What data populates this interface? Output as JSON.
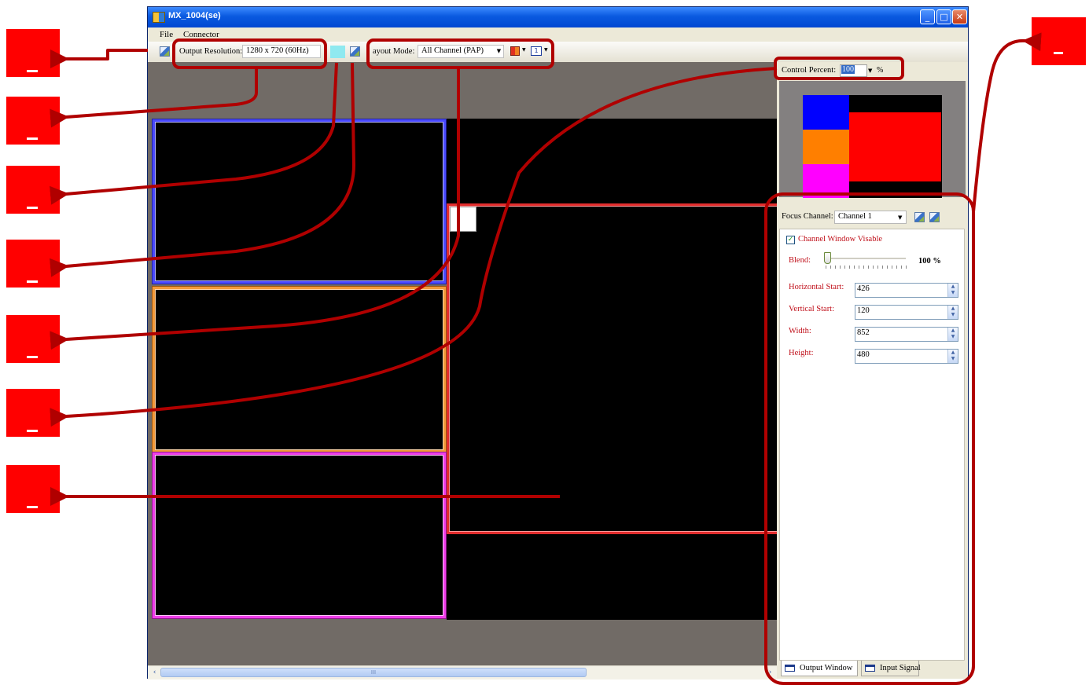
{
  "window": {
    "title": "MX_1004(se)",
    "controls": {
      "minimize": "_",
      "maximize": "□",
      "close": "✕"
    }
  },
  "menu": {
    "file": "File",
    "connector": "Connector"
  },
  "toolbar": {
    "output_resolution_label": "Output Resolution:",
    "output_resolution_value": "1280 x 720 (60Hz)",
    "swatch_color": "#8fe9f0",
    "layout_mode_label": "ayout Mode:",
    "layout_mode_value": "All Channel (PAP)",
    "single_window_icon_text": "1"
  },
  "canvas": {
    "channel_colors": {
      "channel1": "#4a4aff",
      "channel2": "#f39a3a",
      "channel3": "#ee3ee8",
      "focus": "#e22d2d"
    },
    "scroll_grip": "III"
  },
  "right_panel": {
    "control_percent_label": "Control Percent:",
    "control_percent_value": "100",
    "control_percent_unit": "%",
    "focus_channel_label": "Focus Channel:",
    "focus_channel_value": "Channel 1",
    "channel_window_visible_label": "Channel Window Visable",
    "channel_window_visible_checked": true,
    "blend_label": "Blend:",
    "blend_value": "100 %",
    "horizontal_start_label": "Horizontal Start:",
    "horizontal_start_value": "426",
    "vertical_start_label": "Vertical Start:",
    "vertical_start_value": "120",
    "width_label": "Width:",
    "width_value": "852",
    "height_label": "Height:",
    "height_value": "480",
    "tabs": {
      "output_window": "Output Window",
      "input_signal": "Input Signal"
    }
  },
  "preview_colors": {
    "blue": "#0000ff",
    "orange": "#ff7f00",
    "magenta": "#ff00ff",
    "red": "#ff0000"
  },
  "annotation_color": "#b00000"
}
